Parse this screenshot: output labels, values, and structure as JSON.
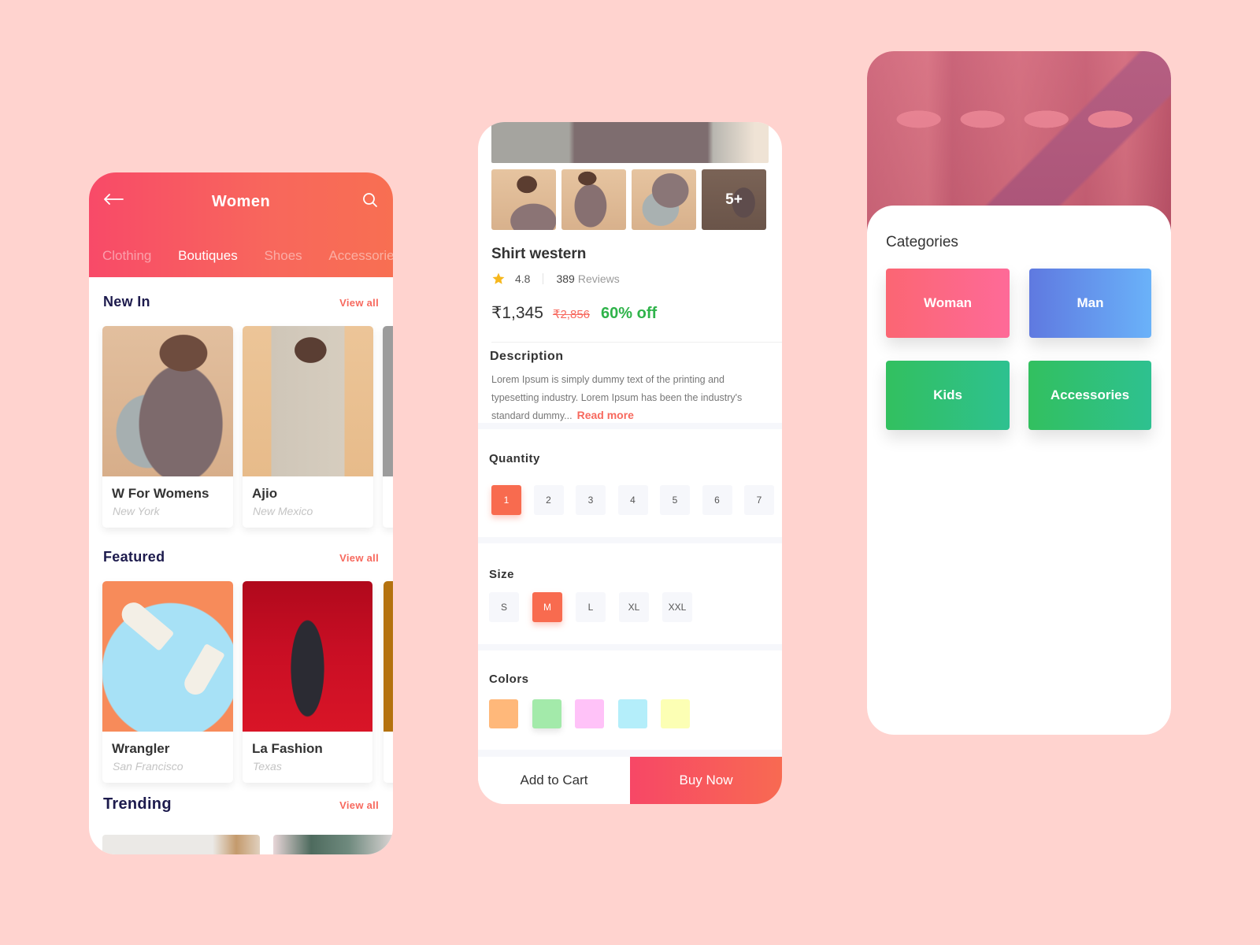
{
  "colors": {
    "background": "#ffd3cf",
    "accent": "#f86b4f",
    "header_gradient_start": "#f84a68",
    "header_gradient_end": "#f86f52",
    "heading_navy": "#1d1b4d",
    "discount_green": "#2fb34a"
  },
  "screen_list": {
    "header": {
      "title": "Women",
      "back_icon": "arrow-left-icon",
      "search_icon": "search-icon"
    },
    "tabs": [
      {
        "label": "Clothing",
        "active": false
      },
      {
        "label": "Boutiques",
        "active": true
      },
      {
        "label": "Shoes",
        "active": false
      },
      {
        "label": "Accessories",
        "active": false
      }
    ],
    "sections": [
      {
        "title": "New In",
        "view_all": "View all",
        "cards": [
          {
            "name": "W For Womens",
            "location": "New York"
          },
          {
            "name": "Ajio",
            "location": "New Mexico"
          }
        ]
      },
      {
        "title": "Featured",
        "view_all": "View all",
        "cards": [
          {
            "name": "Wrangler",
            "location": "San Francisco"
          },
          {
            "name": "La Fashion",
            "location": "Texas"
          }
        ]
      },
      {
        "title": "Trending",
        "view_all": "View all",
        "cards": []
      }
    ]
  },
  "screen_product": {
    "thumbs_more": "5+",
    "title": "Shirt western",
    "rating": "4.8",
    "reviews_count": "389",
    "reviews_label": "Reviews",
    "price_now": "₹1,345",
    "price_old": "₹2,856",
    "discount": "60% off",
    "description_title": "Description",
    "description": "Lorem Ipsum is simply dummy text of the printing and typesetting industry. Lorem Ipsum has been the industry's standard dummy...",
    "read_more": "Read more",
    "quantity": {
      "title": "Quantity",
      "options": [
        "1",
        "2",
        "3",
        "4",
        "5",
        "6",
        "7"
      ],
      "selected": "1"
    },
    "size": {
      "title": "Size",
      "options": [
        "S",
        "M",
        "L",
        "XL",
        "XXL"
      ],
      "selected": "M"
    },
    "colors": {
      "title": "Colors",
      "swatches": [
        "#ffb87a",
        "#a3eaaa",
        "#ffc2f8",
        "#b4eefa",
        "#fcffb4"
      ]
    },
    "add_to_cart": "Add to Cart",
    "buy_now": "Buy Now"
  },
  "screen_categories": {
    "title": "Categories",
    "categories": [
      {
        "label": "Woman"
      },
      {
        "label": "Man"
      },
      {
        "label": "Kids"
      },
      {
        "label": "Accessories"
      }
    ]
  }
}
